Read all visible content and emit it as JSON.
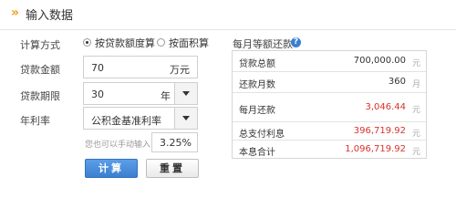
{
  "header": {
    "arrow": "»",
    "title": "输入数据"
  },
  "form": {
    "method_label": "计算方式",
    "method_options": [
      {
        "label": "按贷款额度算",
        "selected": true
      },
      {
        "label": "按面积算",
        "selected": false
      }
    ],
    "amount_label": "贷款金额",
    "amount_value": "70",
    "amount_unit": "万元",
    "term_label": "贷款期限",
    "term_value": "30",
    "term_unit": "年",
    "rate_label": "年利率",
    "rate_select": "公积金基准利率",
    "manual_hint": "您也可以手动输入",
    "rate_value": "3.25%",
    "calc_button": "计算",
    "reset_button": "重置"
  },
  "result": {
    "title": "每月等额还款",
    "help_icon": "?",
    "rows": [
      {
        "label": "贷款总额",
        "value": "700,000.00",
        "unit": "元",
        "highlight": false
      },
      {
        "label": "还款月数",
        "value": "360",
        "unit": "月",
        "highlight": false
      },
      {
        "label": "每月还款",
        "value": "3,046.44",
        "unit": "元",
        "highlight": true
      },
      {
        "label": "总支付利息",
        "value": "396,719.92",
        "unit": "元",
        "highlight": true
      },
      {
        "label": "本息合计",
        "value": "1,096,719.92",
        "unit": "元",
        "highlight": true
      }
    ]
  },
  "colors": {
    "accent_orange": "#f29c1f",
    "primary_blue": "#3b7fd0",
    "value_red": "#d9322b"
  }
}
